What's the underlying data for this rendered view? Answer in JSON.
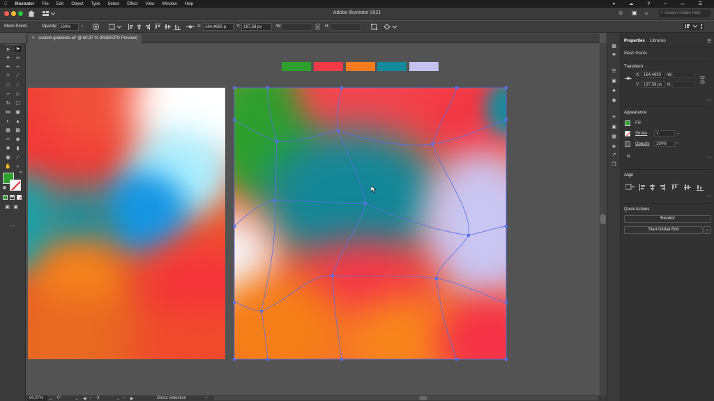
{
  "menubar": {
    "app_name": "Illustrator",
    "items": [
      "File",
      "Edit",
      "Object",
      "Type",
      "Select",
      "Effect",
      "View",
      "Window",
      "Help"
    ],
    "time": "",
    "right_icons": [
      "record-icon",
      "cloud-icon",
      "spotlight-icon",
      "wifi-icon",
      "battery-icon",
      "control-center-icon"
    ]
  },
  "appbar": {
    "title": "Adobe Illustrator 2021",
    "search_placeholder": "Search Adobe Help"
  },
  "controlbar": {
    "selection_label": "Mesh Points",
    "opacity_label": "Opacity:",
    "opacity_value": "100%",
    "x_label": "X:",
    "x_value": "164,4693 p",
    "y_label": "Y:",
    "y_value": "197,58 px",
    "w_label": "W:",
    "h_label": "H:"
  },
  "document": {
    "tab_title": "custom gradients.ai* @ 60,97 % (RGB/CPU Preview)",
    "close_symbol": "×"
  },
  "swatches": [
    "#2ea02e",
    "#f03a48",
    "#f57c1e",
    "#138a9a",
    "#c5c2f0"
  ],
  "fill_color": "#2ea02e",
  "panel": {
    "tabs": [
      "Properties",
      "Libraries"
    ],
    "selection": "Mesh Points",
    "transform_title": "Transform",
    "x_label": "X:",
    "x_value": "164,4693",
    "y_label": "Y:",
    "y_value": "197,58 px",
    "w_label": "W:",
    "h_label": "H:",
    "appearance_title": "Appearance",
    "fill_label": "Fill",
    "stroke_label": "Stroke",
    "opacity_label": "Opacity",
    "opacity_value": "100%",
    "fx_label": "fx.",
    "align_title": "Align",
    "quick_actions_title": "Quick Actions",
    "recolor_label": "Recolor",
    "global_edit_label": "Start Global Edit"
  },
  "status": {
    "zoom": "60,97%",
    "rotation": "0°",
    "artboard": "3",
    "tool": "Direct Selection"
  }
}
